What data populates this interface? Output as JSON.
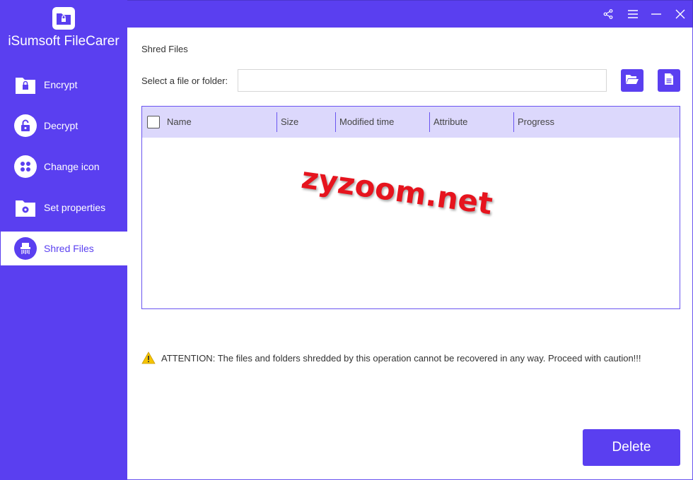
{
  "app": {
    "title": "iSumsoft FileCarer"
  },
  "sidebar": {
    "items": [
      {
        "label": "Encrypt",
        "icon": "folder-lock-icon"
      },
      {
        "label": "Decrypt",
        "icon": "unlock-icon"
      },
      {
        "label": "Change icon",
        "icon": "grid-icon"
      },
      {
        "label": "Set properties",
        "icon": "folder-gear-icon"
      },
      {
        "label": "Shred Files",
        "icon": "shredder-icon",
        "active": true
      }
    ]
  },
  "titlebar": {
    "icons": [
      "share-icon",
      "menu-icon",
      "minimize-icon",
      "close-icon"
    ]
  },
  "main": {
    "page_title": "Shred Files",
    "select_label": "Select a file or folder:",
    "path_value": "",
    "table": {
      "columns": [
        "Name",
        "Size",
        "Modified time",
        "Attribute",
        "Progress"
      ],
      "rows": []
    },
    "watermark": "zyzoom.net",
    "attention": "ATTENTION: The files and folders shredded by this operation cannot be recovered in any way. Proceed with caution!!!",
    "delete_label": "Delete"
  },
  "colors": {
    "accent": "#5a3ff0",
    "header_bg": "#dcd8fc",
    "warning": "#f5c400",
    "watermark": "#e6141e"
  }
}
